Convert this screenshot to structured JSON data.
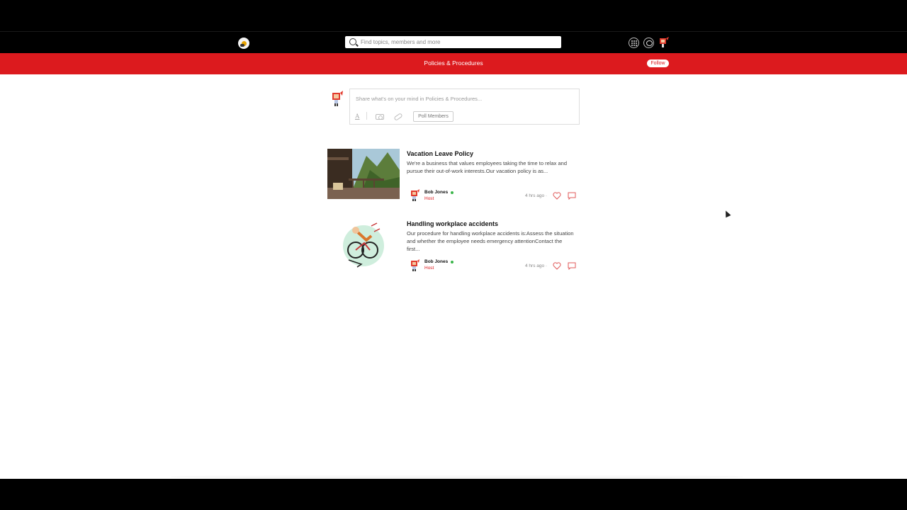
{
  "header": {
    "logo_icon": "egg-logo-icon",
    "search_placeholder": "Find topics, members and more",
    "icons": [
      "apps-grid-icon",
      "chat-icon",
      "user-avatar"
    ]
  },
  "group": {
    "title": "Policies & Procedures",
    "follow_label": "Follow",
    "accent_color": "#dc1a1e"
  },
  "composer": {
    "placeholder": "Share what's on your mind in Policies & Procedures...",
    "text_tool": "A",
    "poll_label": "Poll Members"
  },
  "posts": [
    {
      "title": "Vacation Leave Policy",
      "excerpt": "We're a business that values employees taking the time to relax and pursue their out-of-work interests.Our vacation policy is as...",
      "author": "Bob Jones",
      "role": "Host",
      "time": "4 hrs ago",
      "separator": "·",
      "thumbnail": "mountain-balcony-photo"
    },
    {
      "title": "Handling workplace accidents",
      "excerpt": "Our procedure for handling workplace accidents is:Assess the situation and whether the employee needs emergency attentionContact the first...",
      "author": "Bob Jones",
      "role": "Host",
      "time": "4 hrs ago",
      "separator": "·",
      "thumbnail": "bicycle-accident-illustration"
    }
  ]
}
